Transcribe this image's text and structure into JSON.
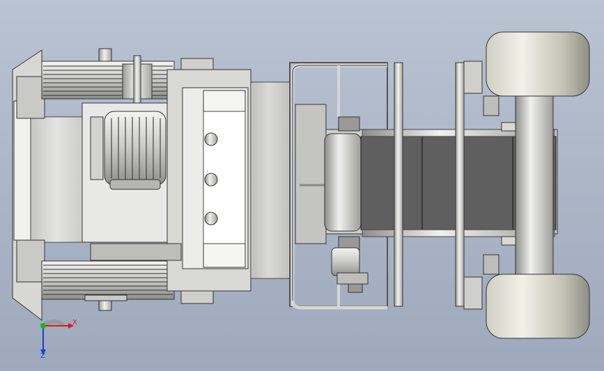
{
  "view": {
    "background_top": "#b9c3d2",
    "background_bottom": "#9ea9bc",
    "metal_light": "#e4e4e2",
    "metal_mid": "#c9c9c6",
    "metal_dark": "#8b8b88",
    "belt_dark": "#5f5f5f"
  },
  "triad": {
    "x_label": "X",
    "z_label": "Z",
    "x_color": "#e01818",
    "y_color": "#1db31d",
    "z_color": "#1a3fd6"
  }
}
